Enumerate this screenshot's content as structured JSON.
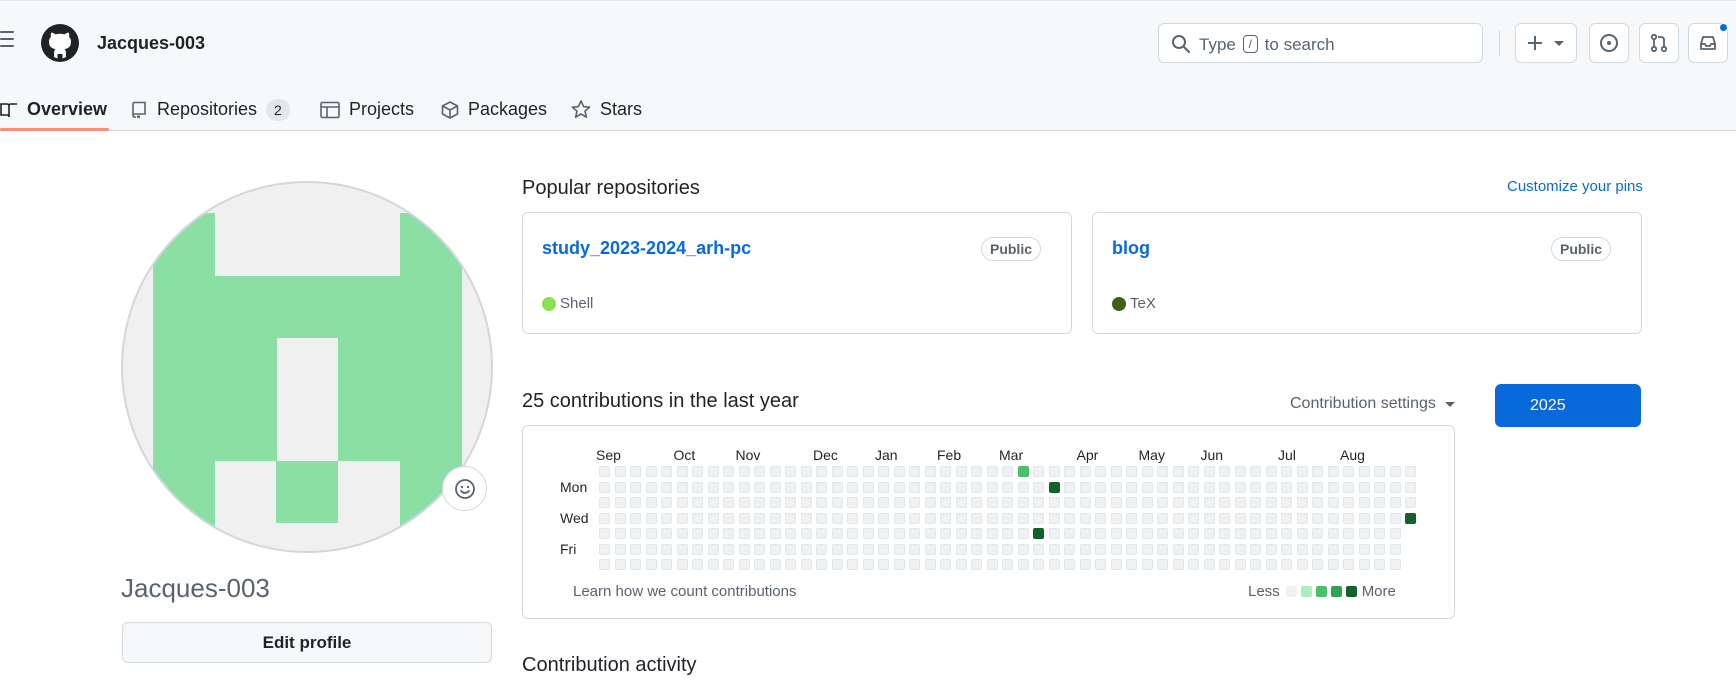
{
  "header": {
    "title": "Jacques-003",
    "search_prefix": "Type",
    "search_key": "/",
    "search_suffix": "to search"
  },
  "tabs": [
    {
      "label": "Overview",
      "icon": "book-icon",
      "active": true
    },
    {
      "label": "Repositories",
      "icon": "repo-icon",
      "count": "2"
    },
    {
      "label": "Projects",
      "icon": "table-icon"
    },
    {
      "label": "Packages",
      "icon": "package-icon"
    },
    {
      "label": "Stars",
      "icon": "star-icon"
    }
  ],
  "profile": {
    "name": "Jacques-003",
    "edit_label": "Edit profile"
  },
  "popular": {
    "title": "Popular repositories",
    "customize_label": "Customize your pins",
    "repos": [
      {
        "name": "study_2023-2024_arh-pc",
        "visibility": "Public",
        "language": "Shell",
        "language_color": "#89e051"
      },
      {
        "name": "blog",
        "visibility": "Public",
        "language": "TeX",
        "language_color": "#3d6117"
      }
    ]
  },
  "contributions": {
    "title": "25 contributions in the last year",
    "settings_label": "Contribution settings",
    "year": "2025",
    "months": [
      "Sep",
      "Oct",
      "Nov",
      "Dec",
      "Jan",
      "Feb",
      "Mar",
      "Apr",
      "May",
      "Jun",
      "Jul",
      "Aug"
    ],
    "days": [
      "Mon",
      "Wed",
      "Fri"
    ],
    "learn_label": "Learn how we count contributions",
    "legend_less": "Less",
    "legend_more": "More",
    "legend_colors": [
      "#eff2f5",
      "#aceebb",
      "#4ac26b",
      "#2da44e",
      "#116329"
    ],
    "active_cells": [
      {
        "week": 27,
        "day": 0,
        "level": 2
      },
      {
        "week": 29,
        "day": 1,
        "level": 4
      },
      {
        "week": 28,
        "day": 4,
        "level": 4
      },
      {
        "week": 52,
        "day": 3,
        "level": 4
      }
    ]
  },
  "activity": {
    "title": "Contribution activity"
  }
}
